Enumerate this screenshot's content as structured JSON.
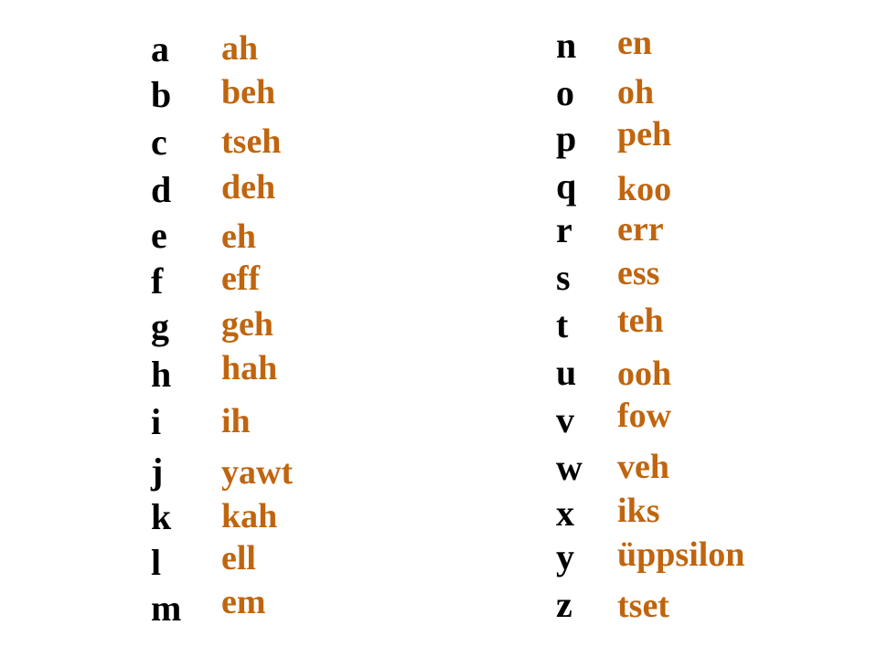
{
  "colors": {
    "letter": "#000000",
    "pronunciation": "#C0650E",
    "background": "#FFFFFF"
  },
  "alphabet": {
    "left": [
      {
        "letter": "a",
        "pronunciation": "ah"
      },
      {
        "letter": "b",
        "pronunciation": "beh"
      },
      {
        "letter": "c",
        "pronunciation": "tseh"
      },
      {
        "letter": "d",
        "pronunciation": "deh"
      },
      {
        "letter": "e",
        "pronunciation": "eh"
      },
      {
        "letter": "f",
        "pronunciation": "eff"
      },
      {
        "letter": "g",
        "pronunciation": "geh"
      },
      {
        "letter": "h",
        "pronunciation": "hah"
      },
      {
        "letter": "i",
        "pronunciation": "ih"
      },
      {
        "letter": "j",
        "pronunciation": "yawt"
      },
      {
        "letter": "k",
        "pronunciation": "kah"
      },
      {
        "letter": "l",
        "pronunciation": "ell"
      },
      {
        "letter": "m",
        "pronunciation": "em"
      }
    ],
    "right": [
      {
        "letter": "n",
        "pronunciation": "en"
      },
      {
        "letter": "o",
        "pronunciation": "oh"
      },
      {
        "letter": "p",
        "pronunciation": "peh"
      },
      {
        "letter": "q",
        "pronunciation": "koo"
      },
      {
        "letter": "r",
        "pronunciation": "err"
      },
      {
        "letter": "s",
        "pronunciation": "ess"
      },
      {
        "letter": "t",
        "pronunciation": "teh"
      },
      {
        "letter": "u",
        "pronunciation": "ooh"
      },
      {
        "letter": "v",
        "pronunciation": "fow"
      },
      {
        "letter": "w",
        "pronunciation": "veh"
      },
      {
        "letter": "x",
        "pronunciation": "iks"
      },
      {
        "letter": "y",
        "pronunciation": "üppsilon"
      },
      {
        "letter": "z",
        "pronunciation": "tset"
      }
    ]
  }
}
